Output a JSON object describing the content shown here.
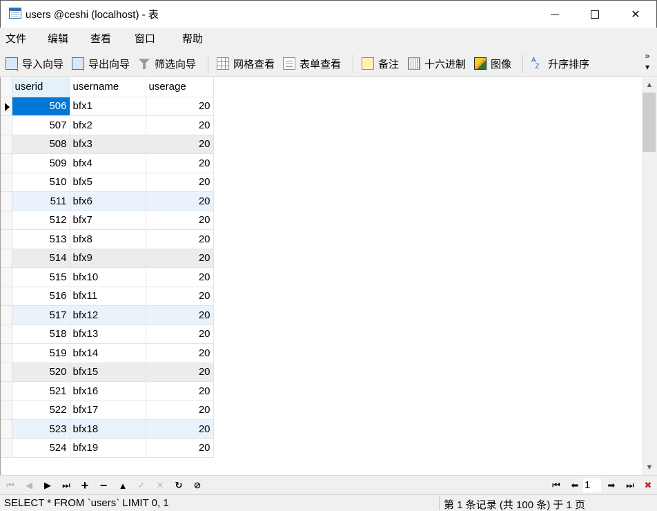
{
  "window": {
    "title": "users @ceshi (localhost) - 表",
    "controls": {
      "minimize": "—",
      "maximize": "☐",
      "close": "✕"
    }
  },
  "menu": [
    "文件",
    "编辑",
    "查看",
    "窗口",
    "帮助"
  ],
  "toolbar": {
    "import_wizard": "导入向导",
    "export_wizard": "导出向导",
    "filter_wizard": "筛选向导",
    "grid_view": "网格查看",
    "form_view": "表单查看",
    "memo": "备注",
    "hex": "十六进制",
    "image": "图像",
    "sort_asc": "升序排序",
    "more": "»"
  },
  "table": {
    "columns": [
      "userid",
      "username",
      "userage"
    ],
    "rows": [
      [
        "506",
        "bfx1",
        "20"
      ],
      [
        "507",
        "bfx2",
        "20"
      ],
      [
        "508",
        "bfx3",
        "20"
      ],
      [
        "509",
        "bfx4",
        "20"
      ],
      [
        "510",
        "bfx5",
        "20"
      ],
      [
        "511",
        "bfx6",
        "20"
      ],
      [
        "512",
        "bfx7",
        "20"
      ],
      [
        "513",
        "bfx8",
        "20"
      ],
      [
        "514",
        "bfx9",
        "20"
      ],
      [
        "515",
        "bfx10",
        "20"
      ],
      [
        "516",
        "bfx11",
        "20"
      ],
      [
        "517",
        "bfx12",
        "20"
      ],
      [
        "518",
        "bfx13",
        "20"
      ],
      [
        "519",
        "bfx14",
        "20"
      ],
      [
        "520",
        "bfx15",
        "20"
      ],
      [
        "521",
        "bfx16",
        "20"
      ],
      [
        "522",
        "bfx17",
        "20"
      ],
      [
        "523",
        "bfx18",
        "20"
      ],
      [
        "524",
        "bfx19",
        "20"
      ]
    ]
  },
  "navigation": {
    "page_number": "1"
  },
  "status": {
    "sql": "SELECT * FROM `users` LIMIT 0, 1",
    "page_info": "第 1 条记录 (共 100 条) 于 1 页"
  },
  "colors": {
    "selection": "#0078d7",
    "row_highlight_gray": "#ececec",
    "row_highlight_blue": "#eaf3fc",
    "chrome": "#f0f0f0"
  }
}
